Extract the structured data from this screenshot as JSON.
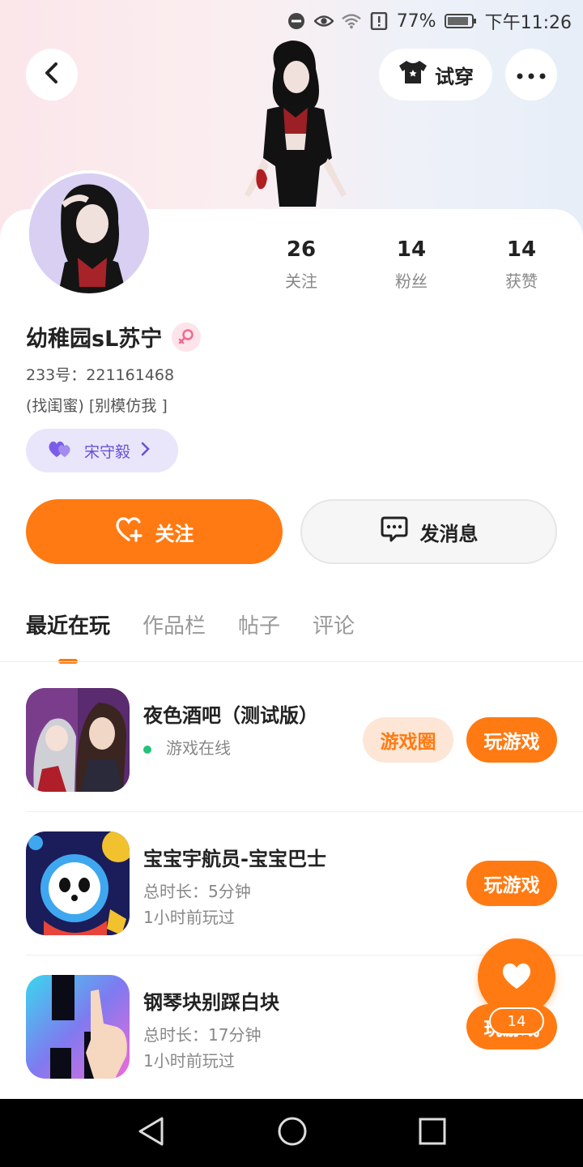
{
  "status_bar": {
    "battery": "77%",
    "time": "下午11:26"
  },
  "header": {
    "try_on_label": "试穿"
  },
  "stats": [
    {
      "value": "26",
      "label": "关注"
    },
    {
      "value": "14",
      "label": "粉丝"
    },
    {
      "value": "14",
      "label": "获赞"
    }
  ],
  "profile": {
    "name": "幼稚园sL苏宁",
    "id_text": "233号：221161468",
    "bio": "(找闺蜜) [别模仿我 ]",
    "bestie": "宋守毅"
  },
  "actions": {
    "follow": "关注",
    "message": "发消息"
  },
  "tabs": [
    {
      "label": "最近在玩",
      "active": true
    },
    {
      "label": "作品栏",
      "active": false
    },
    {
      "label": "帖子",
      "active": false
    },
    {
      "label": "评论",
      "active": false
    }
  ],
  "games": [
    {
      "title": "夜色酒吧（测试版）",
      "status": "游戏在线",
      "circle_label": "游戏圈",
      "play_label": "玩游戏"
    },
    {
      "title": "宝宝宇航员-宝宝巴士",
      "duration": "总时长：5分钟",
      "last_played": "1小时前玩过",
      "play_label": "玩游戏"
    },
    {
      "title": "钢琴块别踩白块",
      "duration": "总时长：17分钟",
      "last_played": "1小时前玩过",
      "play_label": "玩游戏"
    }
  ],
  "like_fab": {
    "count": "14"
  },
  "colors": {
    "accent": "#ff7a12",
    "online": "#22c27a",
    "purple": "#6b4fd8"
  }
}
